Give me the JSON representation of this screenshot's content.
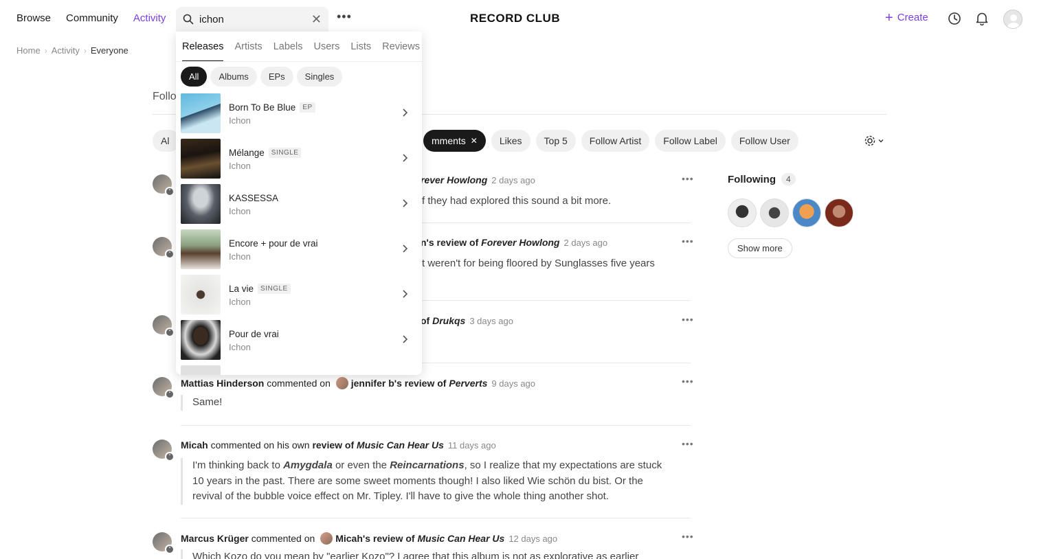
{
  "nav": {
    "browse": "Browse",
    "community": "Community",
    "activity": "Activity"
  },
  "search": {
    "value": "ichon",
    "placeholder": ""
  },
  "logo": "RECORD CLUB",
  "header": {
    "create_label": "Create"
  },
  "breadcrumb": {
    "home": "Home",
    "activity": "Activity",
    "current": "Everyone"
  },
  "page": {
    "follow_title_visible": "Follo"
  },
  "filters": {
    "visible_left": "Al",
    "comments_partial": "mments",
    "items": [
      "Likes",
      "Top 5",
      "Follow Artist",
      "Follow Label",
      "Follow User"
    ]
  },
  "dropdown": {
    "tabs": [
      "Releases",
      "Artists",
      "Labels",
      "Users",
      "Lists",
      "Reviews"
    ],
    "chips": [
      "All",
      "Albums",
      "EPs",
      "Singles"
    ],
    "results": [
      {
        "title": "Born To Be Blue",
        "badge": "EP",
        "artist": "Ichon"
      },
      {
        "title": "Mélange",
        "badge": "SINGLE",
        "artist": "Ichon"
      },
      {
        "title": "KASSESSA",
        "badge": "",
        "artist": "Ichon"
      },
      {
        "title": "Encore + pour de vrai",
        "badge": "",
        "artist": "Ichon"
      },
      {
        "title": "La vie",
        "badge": "SINGLE",
        "artist": "Ichon"
      },
      {
        "title": "Pour de vrai",
        "badge": "",
        "artist": "Ichon"
      }
    ]
  },
  "feed": {
    "item1": {
      "album": "rever Howlong",
      "ago": "2 days ago",
      "quote": "f they had explored this sound a bit more."
    },
    "item2": {
      "prefix": "n's review of",
      "album": "Forever Howlong",
      "ago": "2 days ago",
      "quote": "t weren't for being floored by Sunglasses five years"
    },
    "item3": {
      "prefix": "of",
      "album": "Drukqs",
      "ago": "3 days ago"
    },
    "item4": {
      "user": "Mattias Hinderson",
      "verb": "commented on",
      "target": "jennifer b",
      "suffix": "'s review of",
      "album": "Perverts",
      "ago": "9 days ago",
      "quote": "Same!"
    },
    "item5": {
      "user": "Micah",
      "verb": "commented on his own",
      "review": "review of",
      "album": "Music Can Hear Us",
      "ago": "11 days ago",
      "q1a": "I'm thinking back to ",
      "q1b": "Amygdala",
      "q1c": " or even the ",
      "q1d": "Reincarnations",
      "q1e": ", so I realize that my expectations are stuck",
      "q2": "10 years in the past. There are some sweet moments though! I also liked Wie schön du bist. Or the",
      "q3": "revival of the bubble voice effect on Mr. Tipley. I'll have to give the whole thing another shot."
    },
    "item6": {
      "user": "Marcus Krüger",
      "verb": "commented on",
      "target": "Micah",
      "suffix": "'s review of",
      "album": "Music Can Hear Us",
      "ago": "12 days ago",
      "quote": "Which Kozo do you mean by \"earlier Kozo\"? I agree that this album is not as explorative as earlier"
    }
  },
  "following": {
    "title": "Following",
    "count": "4",
    "show_more": "Show more"
  },
  "colors": {
    "accent": "#7b3fe4",
    "chip_bg": "#f0f0f0",
    "dark": "#1a1a1a"
  }
}
